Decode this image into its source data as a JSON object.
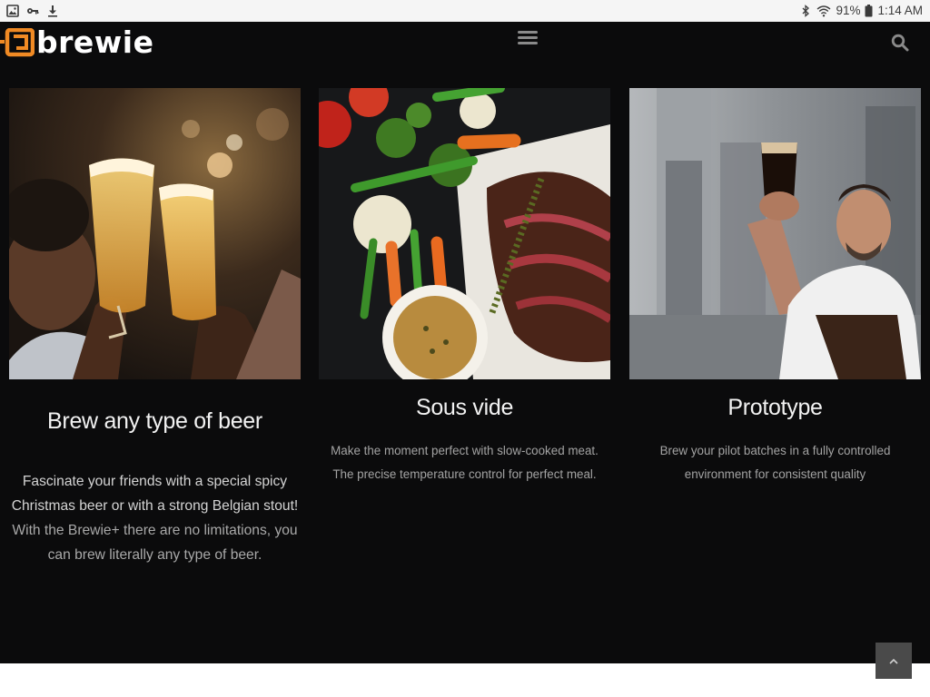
{
  "status_bar": {
    "left_icons": [
      "gallery-icon",
      "key-icon",
      "download-icon"
    ],
    "right_icons": [
      "bluetooth-icon",
      "wifi-icon",
      "battery-icon"
    ],
    "battery": "91%",
    "time": "1:14 AM"
  },
  "header": {
    "logo_text": "brewie",
    "menu_icon": "hamburger-menu-icon",
    "search_icon": "search-icon",
    "brand_color": "#f08a24"
  },
  "cards": [
    {
      "image": "friends toasting glasses of beer",
      "title": "Brew any type of beer",
      "body_strong": "Fascinate your friends with a special spicy Christmas beer or with a strong Belgian stout!",
      "body": " With the Brewie+ there are no limitations, you can brew literally any type of beer."
    },
    {
      "image": "sliced steak with vegetables and sauce",
      "title": "Sous vide",
      "body": "Make the moment perfect with slow-cooked meat. The precise temperature control for perfect meal."
    },
    {
      "image": "brewer holding a glass of dark beer",
      "title": "Prototype",
      "body": "Brew your pilot batches in a fully controlled environment for consistent quality"
    }
  ],
  "scroll_top_icon": "chevron-up-icon"
}
